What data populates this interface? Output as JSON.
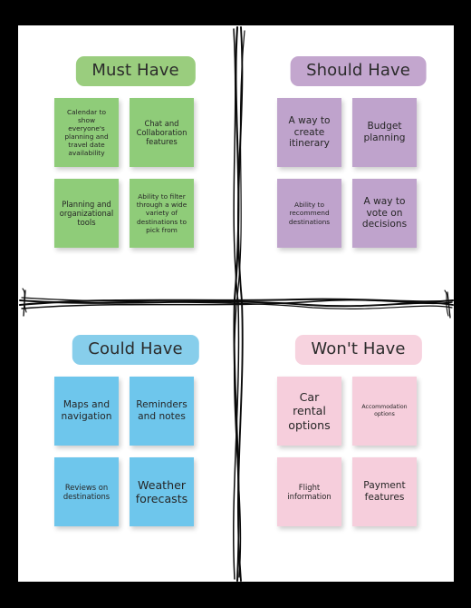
{
  "board": {
    "frame_color": "#000000",
    "canvas_color": "#ffffff",
    "divider_color": "#0a0a0a"
  },
  "quadrants": [
    {
      "id": "must-have",
      "header": "Must Have",
      "header_color": "#9ACD7E",
      "note_color": "#8FCC79",
      "notes": [
        {
          "text": "Calendar to show everyone's planning and travel date availability",
          "size": "fs-s"
        },
        {
          "text": "Chat and Collaboration features",
          "size": "fs-m"
        },
        {
          "text": "Planning and organizational tools",
          "size": "fs-m"
        },
        {
          "text": "Ability to filter through a wide variety of destinations to pick from",
          "size": "fs-s"
        }
      ]
    },
    {
      "id": "should-have",
      "header": "Should Have",
      "header_color": "#C3A6CE",
      "note_color": "#BFA3CC",
      "notes": [
        {
          "text": "A way to create itinerary",
          "size": "fs-l"
        },
        {
          "text": "Budget planning",
          "size": "fs-l"
        },
        {
          "text": "Ability to recommend destinations",
          "size": "fs-s"
        },
        {
          "text": "A way to vote on decisions",
          "size": "fs-l"
        }
      ]
    },
    {
      "id": "could-have",
      "header": "Could Have",
      "header_color": "#87CEEB",
      "note_color": "#6EC6EC",
      "notes": [
        {
          "text": "Maps and navigation",
          "size": "fs-l"
        },
        {
          "text": "Reminders and notes",
          "size": "fs-l"
        },
        {
          "text": "Reviews on destinations",
          "size": "fs-m"
        },
        {
          "text": "Weather forecasts",
          "size": "fs-xl"
        }
      ]
    },
    {
      "id": "wont-have",
      "header": "Won't Have",
      "header_color": "#F7D3DF",
      "note_color": "#F6CEDC",
      "notes": [
        {
          "text": "Car rental options",
          "size": "fs-xl"
        },
        {
          "text": "Accommodation options",
          "size": "fs-xs"
        },
        {
          "text": "Flight information",
          "size": "fs-m"
        },
        {
          "text": "Payment features",
          "size": "fs-l"
        }
      ]
    }
  ]
}
